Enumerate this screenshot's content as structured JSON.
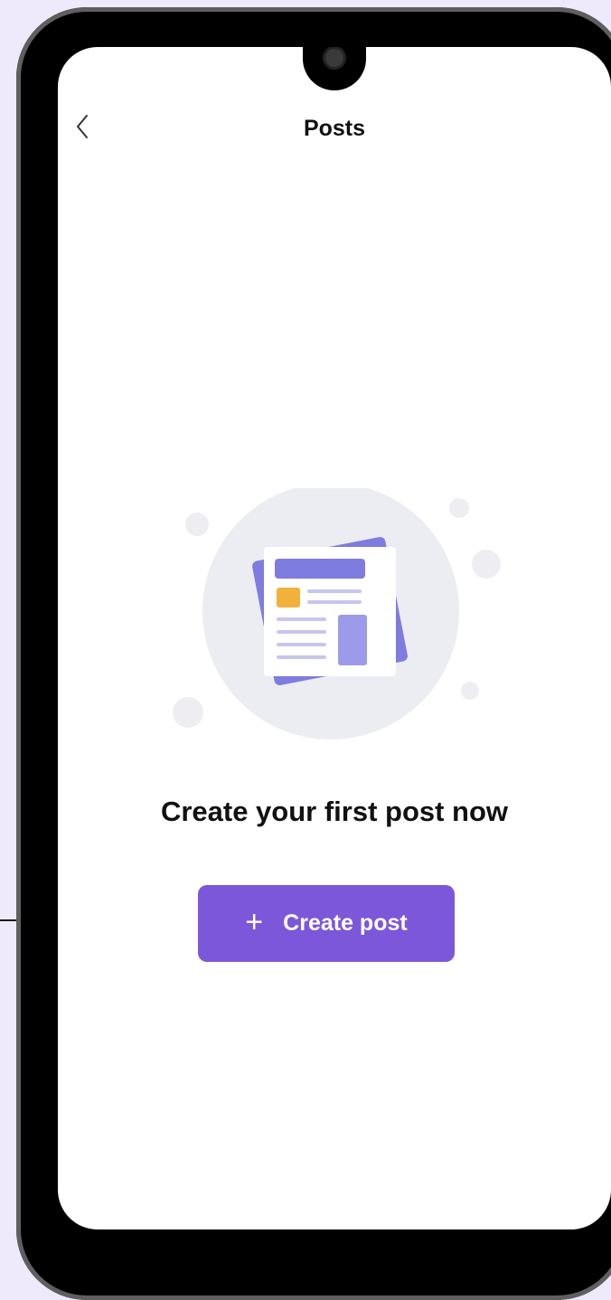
{
  "header": {
    "title": "Posts",
    "back_icon": "chevron-left-icon"
  },
  "empty_state": {
    "illustration_icon": "newspaper-icon",
    "heading": "Create your first post now"
  },
  "primary_action": {
    "icon": "plus-icon",
    "plus_glyph": "+",
    "label": "Create post"
  },
  "colors": {
    "accent": "#7d57da",
    "page_background": "#efeafb",
    "illustration_circle": "#ecedf2",
    "illustration_purple": "#7f7ce0",
    "illustration_light_purple": "#9c9be9",
    "illustration_orange": "#f2b13a"
  }
}
